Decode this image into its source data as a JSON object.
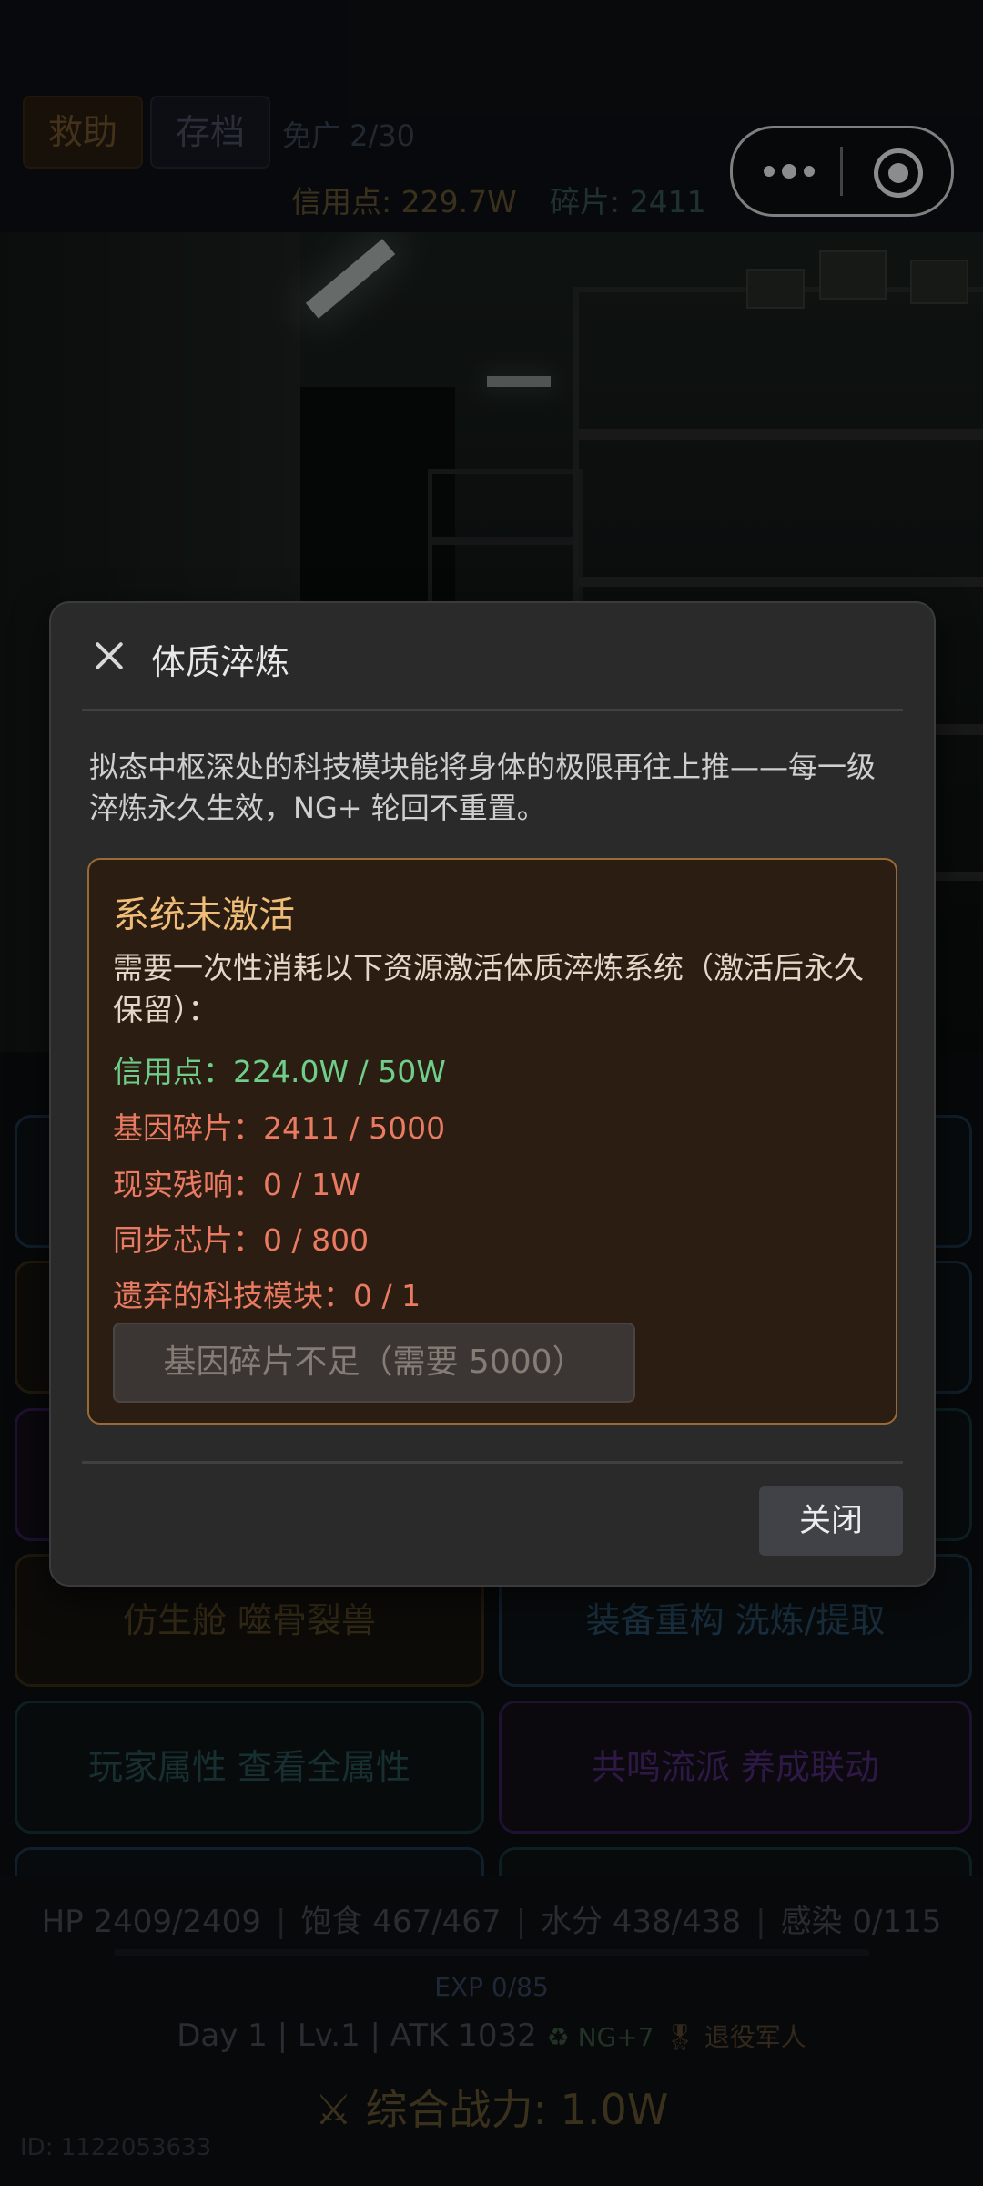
{
  "header": {
    "rescue_label": "救助",
    "save_label": "存档",
    "ad_count": "免广 2/30",
    "credits": "信用点: 229.7W",
    "shards": "碎片: 2411"
  },
  "grid_buttons": [
    {
      "label": "仿生舱 噬骨裂兽",
      "color": "gold"
    },
    {
      "label": "装备重构 洗炼/提取",
      "color": "blue"
    },
    {
      "label": "玩家属性 查看全属性",
      "color": "teal"
    },
    {
      "label": "共鸣流派 养成联动",
      "color": "purple"
    }
  ],
  "status": {
    "hp": "HP 2409/2409",
    "satiety": "饱食 467/467",
    "water": "水分 438/438",
    "infection": "感染 0/115",
    "exp_text": "EXP 0/85",
    "exp_progress": 0,
    "day_line": "Day 1 | Lv.1 | ATK 1032",
    "ng_badge": "♻ NG+7",
    "role_badge": "🎖 退役军人",
    "power": "⚔ 综合战力: 1.0W",
    "user_id": "ID: 1122053633"
  },
  "modal": {
    "title": "体质淬炼",
    "description": "拟态中枢深处的科技模块能将身体的极限再往上推——每一级淬炼永久生效，NG+ 轮回不重置。",
    "card_title": "系统未激活",
    "card_text": "需要一次性消耗以下资源激活体质淬炼系统（激活后永久保留）：",
    "requirements": [
      {
        "text": "信用点：224.0W / 50W",
        "met": true
      },
      {
        "text": "基因碎片：2411 / 5000",
        "met": false
      },
      {
        "text": "现实残响：0 / 1W",
        "met": false
      },
      {
        "text": "同步芯片：0 / 800",
        "met": false
      },
      {
        "text": "遗弃的科技模块：0 / 1",
        "met": false
      }
    ],
    "action_label": "基因碎片不足（需要 5000）",
    "close_label": "关闭"
  }
}
